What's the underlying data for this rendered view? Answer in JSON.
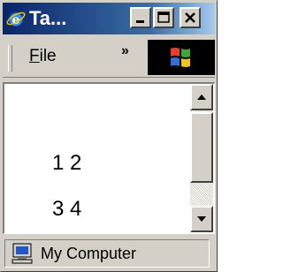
{
  "window": {
    "title": "Ta...",
    "controls": {
      "minimize": "minimize",
      "maximize": "maximize",
      "close": "close"
    }
  },
  "menubar": {
    "file_label_underlined": "F",
    "file_label_rest": "ile",
    "chevron": "»"
  },
  "content": {
    "lines": [
      "1 2",
      "3 4"
    ]
  },
  "statusbar": {
    "zone_label": "My Computer"
  },
  "colors": {
    "title_gradient_start": "#0a246a",
    "title_gradient_end": "#a6caf0",
    "chrome": "#d4d0c8",
    "throbber": "#000000"
  }
}
